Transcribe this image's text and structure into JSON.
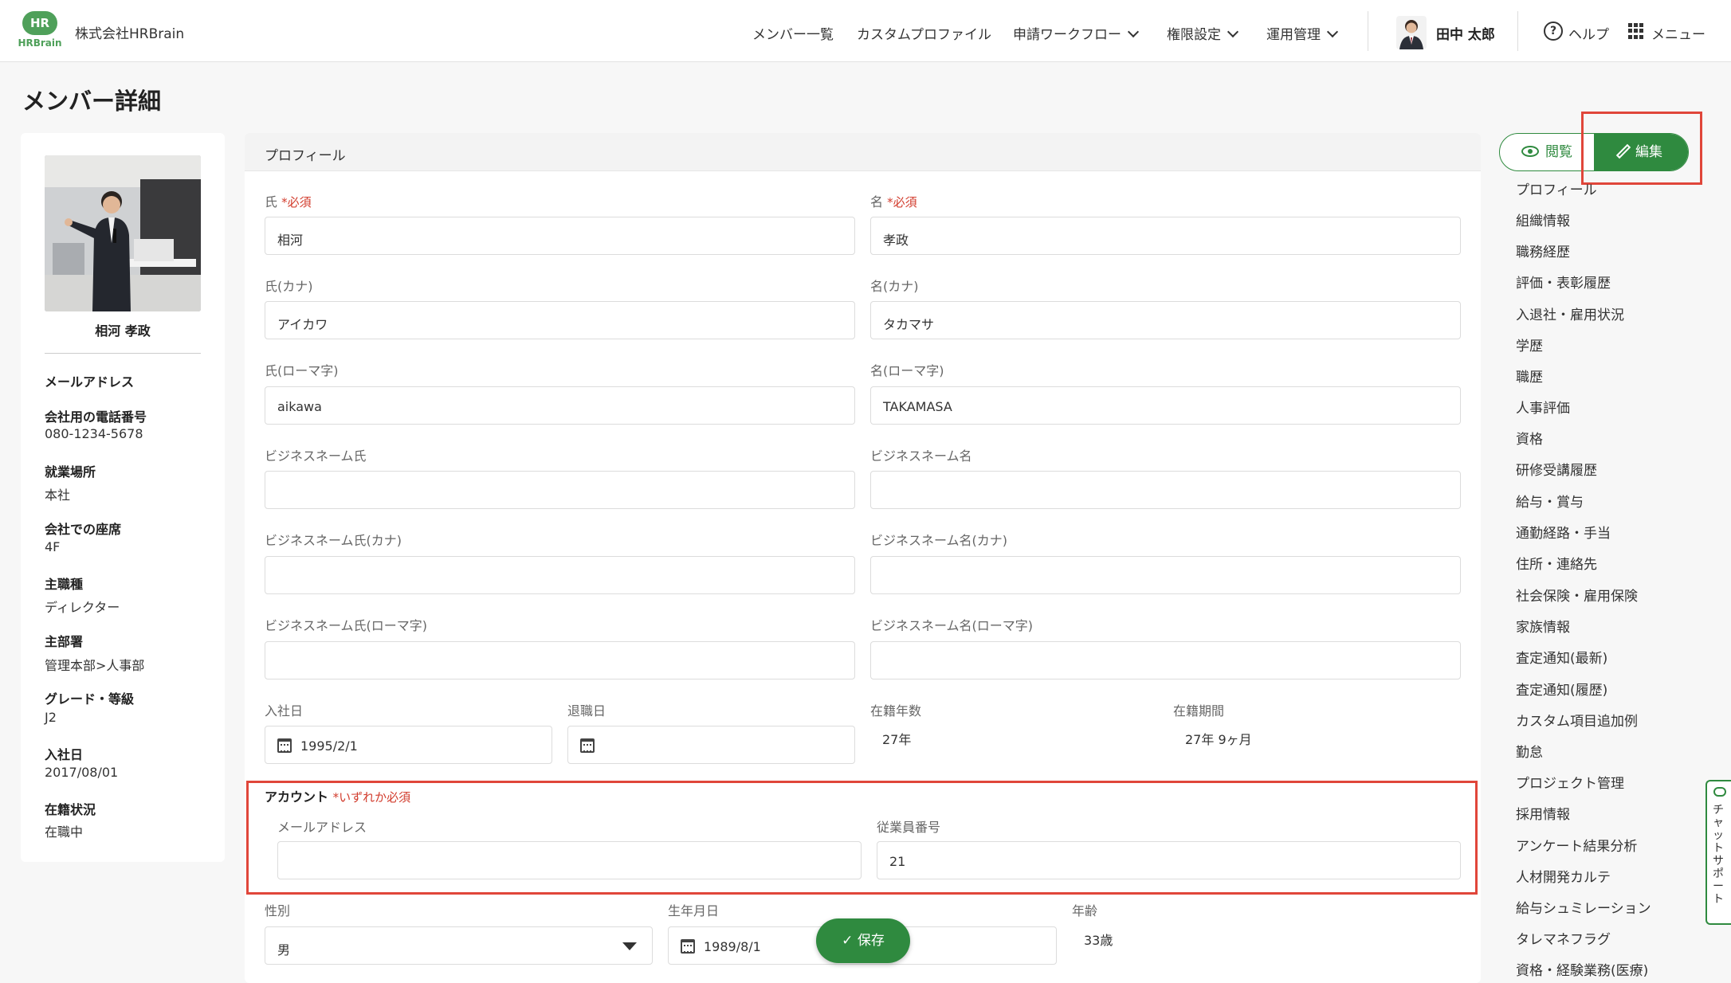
{
  "header": {
    "logo_mark": "HR",
    "logo_text": "HRBrain",
    "company": "株式会社HRBrain",
    "nav": [
      "メンバー一覧",
      "カスタムプロファイル",
      "申請ワークフロー",
      "権限設定",
      "運用管理"
    ],
    "user_name": "田中 太郎",
    "help": "ヘルプ",
    "menu": "メニュー"
  },
  "page_title": "メンバー詳細",
  "summary": {
    "name": "相河 孝政",
    "fields": [
      {
        "label": "メールアドレス",
        "value": ""
      },
      {
        "label": "会社用の電話番号",
        "value": "080-1234-5678"
      },
      {
        "label": "就業場所",
        "value": "本社"
      },
      {
        "label": "会社での座席",
        "value": "4F"
      },
      {
        "label": "主職種",
        "value": "ディレクター"
      },
      {
        "label": "主部署",
        "value": "管理本部>人事部"
      },
      {
        "label": "グレード・等級",
        "value": "J2"
      },
      {
        "label": "入社日",
        "value": "2017/08/01"
      },
      {
        "label": "在籍状況",
        "value": "在職中"
      }
    ]
  },
  "form": {
    "section_title": "プロフィール",
    "required_mark": "*必須",
    "last_name": {
      "label": "氏",
      "value": "相河"
    },
    "first_name": {
      "label": "名",
      "value": "孝政"
    },
    "last_name_kana": {
      "label": "氏(カナ)",
      "value": "アイカワ"
    },
    "first_name_kana": {
      "label": "名(カナ)",
      "value": "タカマサ"
    },
    "last_name_roman": {
      "label": "氏(ローマ字)",
      "value": "aikawa"
    },
    "first_name_roman": {
      "label": "名(ローマ字)",
      "value": "TAKAMASA"
    },
    "biz_last": {
      "label": "ビジネスネーム氏",
      "value": ""
    },
    "biz_first": {
      "label": "ビジネスネーム名",
      "value": ""
    },
    "biz_last_kana": {
      "label": "ビジネスネーム氏(カナ)",
      "value": ""
    },
    "biz_first_kana": {
      "label": "ビジネスネーム名(カナ)",
      "value": ""
    },
    "biz_last_roman": {
      "label": "ビジネスネーム氏(ローマ字)",
      "value": ""
    },
    "biz_first_roman": {
      "label": "ビジネスネーム名(ローマ字)",
      "value": ""
    },
    "join_date": {
      "label": "入社日",
      "value": "1995/2/1"
    },
    "leave_date": {
      "label": "退職日",
      "value": ""
    },
    "tenure_years": {
      "label": "在籍年数",
      "value": "27年"
    },
    "tenure_period": {
      "label": "在籍期間",
      "value": "27年 9ヶ月"
    },
    "account": {
      "label": "アカウント",
      "note": "*いずれか必須",
      "email": {
        "label": "メールアドレス",
        "value": ""
      },
      "employee_no": {
        "label": "従業員番号",
        "value": "21"
      }
    },
    "gender": {
      "label": "性別",
      "value": "男"
    },
    "birthday": {
      "label": "生年月日",
      "value": "1989/8/1"
    },
    "age": {
      "label": "年齢",
      "value": "33歳"
    },
    "save": "保存"
  },
  "right": {
    "view": "閲覧",
    "edit": "編集",
    "sections": [
      "プロフィール",
      "組織情報",
      "職務経歴",
      "評価・表彰履歴",
      "入退社・雇用状況",
      "学歴",
      "職歴",
      "人事評価",
      "資格",
      "研修受講履歴",
      "給与・賞与",
      "通勤経路・手当",
      "住所・連絡先",
      "社会保険・雇用保険",
      "家族情報",
      "査定通知(最新)",
      "査定通知(履歴)",
      "カスタム項目追加例",
      "勤怠",
      "プロジェクト管理",
      "採用情報",
      "アンケート結果分析",
      "人材開発カルテ",
      "給与シュミレーション",
      "タレマネフラグ",
      "資格・経験業務(医療)"
    ],
    "chat_support": "チャットサポート"
  },
  "colors": {
    "accent": "#2f8a3f",
    "required": "#d23c2d",
    "highlight": "#e0463a"
  }
}
